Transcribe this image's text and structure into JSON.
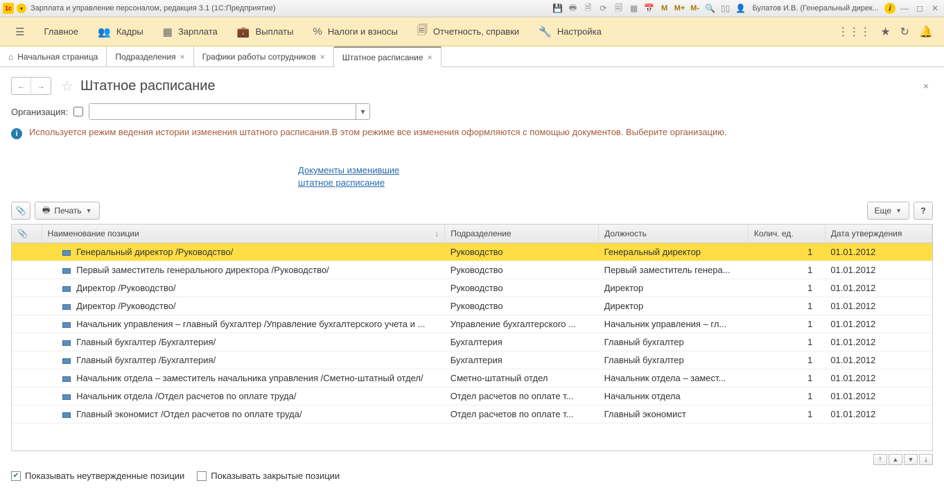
{
  "titlebar": {
    "app_title": "Зарплата и управление персоналом, редакция 3.1  (1С:Предприятие)",
    "user": "Булатов И.В. (Генеральный дирек...",
    "m": "M",
    "mplus": "M+",
    "mminus": "M-"
  },
  "menu": {
    "burger_icon": "☰",
    "items": [
      {
        "icon": "",
        "label": "Главное"
      },
      {
        "icon": "👥",
        "label": "Кадры"
      },
      {
        "icon": "▦",
        "label": "Зарплата"
      },
      {
        "icon": "💼",
        "label": "Выплаты"
      },
      {
        "icon": "%",
        "label": "Налоги и взносы"
      },
      {
        "icon": "🗐",
        "label": "Отчетность, справки"
      },
      {
        "icon": "🔧",
        "label": "Настройка"
      }
    ]
  },
  "tabs": [
    {
      "label": "Начальная страница",
      "home": true,
      "closable": false
    },
    {
      "label": "Подразделения",
      "closable": true
    },
    {
      "label": "Графики работы сотрудников",
      "closable": true
    },
    {
      "label": "Штатное расписание",
      "closable": true,
      "active": true
    }
  ],
  "page": {
    "title": "Штатное расписание",
    "org_label": "Организация:",
    "info_msg": "Используется режим ведения истории изменения штатного расписания.В этом режиме все изменения оформляются с помощью документов. Выберите организацию.",
    "doc_link1": "Документы изменившие",
    "doc_link2": "штатное расписание"
  },
  "toolbar": {
    "print": "Печать",
    "more": "Еще",
    "help": "?"
  },
  "table": {
    "headers": {
      "name": "Наименование позиции",
      "dept": "Подразделение",
      "role": "Должность",
      "qty": "Колич. ед.",
      "date": "Дата утверждения"
    },
    "rows": [
      {
        "name": "Генеральный директор /Руководство/",
        "dept": "Руководство",
        "role": "Генеральный директор",
        "qty": "1",
        "date": "01.01.2012",
        "sel": true
      },
      {
        "name": "Первый заместитель генерального директора /Руководство/",
        "dept": "Руководство",
        "role": "Первый заместитель генера...",
        "qty": "1",
        "date": "01.01.2012"
      },
      {
        "name": "Директор /Руководство/",
        "dept": "Руководство",
        "role": "Директор",
        "qty": "1",
        "date": "01.01.2012"
      },
      {
        "name": "Директор /Руководство/",
        "dept": "Руководство",
        "role": "Директор",
        "qty": "1",
        "date": "01.01.2012"
      },
      {
        "name": "Начальник управления – главный бухгалтер /Управление бухгалтерского учета и ...",
        "dept": "Управление бухгалтерского ...",
        "role": "Начальник управления – гл...",
        "qty": "1",
        "date": "01.01.2012"
      },
      {
        "name": "Главный бухгалтер /Бухгалтерия/",
        "dept": "Бухгалтерия",
        "role": "Главный бухгалтер",
        "qty": "1",
        "date": "01.01.2012"
      },
      {
        "name": "Главный бухгалтер /Бухгалтерия/",
        "dept": "Бухгалтерия",
        "role": "Главный бухгалтер",
        "qty": "1",
        "date": "01.01.2012"
      },
      {
        "name": "Начальник отдела – заместитель начальника управления /Сметно-штатный отдел/",
        "dept": "Сметно-штатный отдел",
        "role": "Начальник отдела – замест...",
        "qty": "1",
        "date": "01.01.2012"
      },
      {
        "name": "Начальник отдела /Отдел расчетов по оплате труда/",
        "dept": "Отдел расчетов по оплате т...",
        "role": "Начальник отдела",
        "qty": "1",
        "date": "01.01.2012"
      },
      {
        "name": "Главный экономист /Отдел расчетов по оплате труда/",
        "dept": "Отдел расчетов по оплате т...",
        "role": "Главный экономист",
        "qty": "1",
        "date": "01.01.2012"
      }
    ]
  },
  "bottom": {
    "show_unapproved": "Показывать неутвержденные позиции",
    "show_closed": "Показывать закрытые позиции"
  }
}
